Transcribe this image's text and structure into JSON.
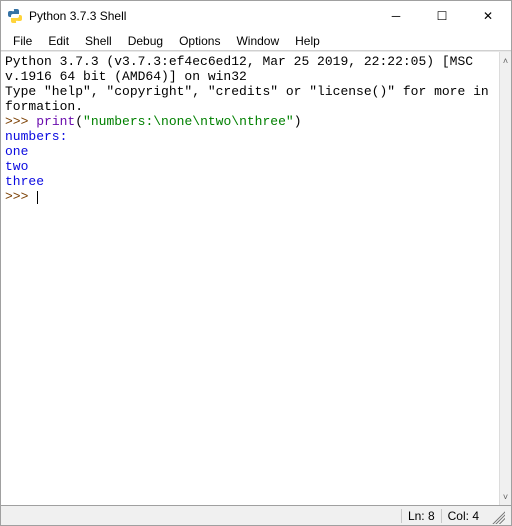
{
  "window": {
    "title": "Python 3.7.3 Shell"
  },
  "menu": {
    "items": [
      "File",
      "Edit",
      "Shell",
      "Debug",
      "Options",
      "Window",
      "Help"
    ]
  },
  "shell": {
    "banner1": "Python 3.7.3 (v3.7.3:ef4ec6ed12, Mar 25 2019, 22:22:05) [MSC v.1916 64 bit (AMD64)] on win32",
    "banner2": "Type \"help\", \"copyright\", \"credits\" or \"license()\" for more information.",
    "prompt": ">>>",
    "input_builtin": "print",
    "input_paren_open": "(",
    "input_string": "\"numbers:\\none\\ntwo\\nthree\"",
    "input_paren_close": ")",
    "output_lines": [
      "numbers:",
      "one",
      "two",
      "three"
    ]
  },
  "status": {
    "ln_label": "Ln: 8",
    "col_label": "Col: 4"
  },
  "icons": {
    "minimize": "─",
    "maximize": "☐",
    "close": "✕",
    "scroll_up": "˄",
    "scroll_down": "˅"
  }
}
